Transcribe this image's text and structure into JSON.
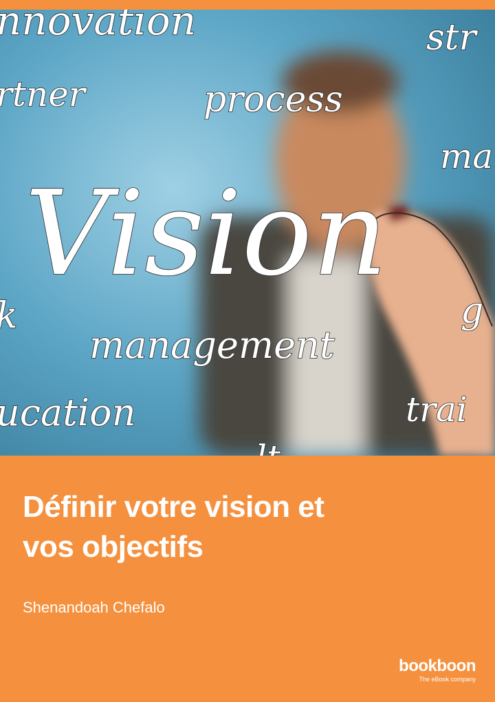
{
  "cover": {
    "background_color": "#f5913e",
    "photo": {
      "handwritten_words": [
        "nnovation",
        "str",
        "rtner",
        "process",
        "ma",
        "Vision",
        "k",
        "g",
        "management",
        "ucation",
        "trai",
        "lt"
      ]
    },
    "title_lines": [
      "Définir votre vision et",
      "vos objectifs"
    ],
    "author": "Shenandoah Chefalo",
    "publisher": {
      "name": "bookboon",
      "tagline": "The eBook company"
    }
  }
}
